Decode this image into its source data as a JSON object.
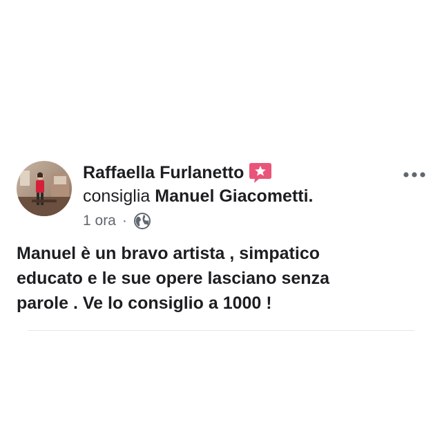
{
  "post": {
    "author_name": "Raffaella Furlanetto",
    "recommendation_badge_icon": "star-icon",
    "rec_verb": "consiglia",
    "rec_target": "Manuel Giacometti.",
    "timestamp": "1 ora",
    "separator": "·",
    "privacy_icon": "globe-icon",
    "more_icon": "more-dots-icon",
    "body_text": "Manuel è un bravo artista , simpatico\neducato e le sue opere lasciano senza\nparole . Ve lo consiglio a 1000 !"
  },
  "colors": {
    "text_primary": "#1c1e21",
    "text_secondary": "#606770",
    "badge_pink": "#e9557a",
    "divider": "#e4e6eb"
  }
}
